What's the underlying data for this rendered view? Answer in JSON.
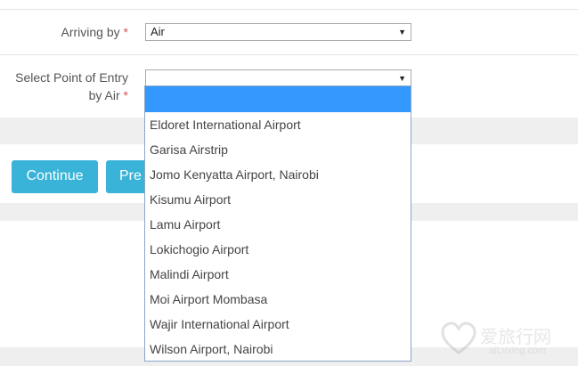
{
  "form": {
    "arriving_by": {
      "label": "Arriving by",
      "required_mark": "*",
      "value": "Air"
    },
    "point_of_entry": {
      "label_line1": "Select Point of Entry",
      "label_line2": "by Air",
      "required_mark": "*",
      "value": ""
    }
  },
  "dropdown": {
    "options": [
      "Eldoret International Airport",
      "Garisa Airstrip",
      "Jomo Kenyatta Airport, Nairobi",
      "Kisumu Airport",
      "Lamu Airport",
      "Lokichogio Airport",
      "Malindi Airport",
      "Moi Airport Mombasa",
      "Wajir International Airport",
      "Wilson Airport, Nairobi"
    ]
  },
  "buttons": {
    "continue": "Continue",
    "previous_partial": "Pre"
  },
  "watermark": {
    "text": "爱旅行网",
    "sub": "aiLvxing.com"
  },
  "icons": {
    "select_arrow": "caret-down-icon"
  },
  "colors": {
    "button": "#39b3d7",
    "highlight": "#3399ff",
    "required": "#d9534f"
  }
}
